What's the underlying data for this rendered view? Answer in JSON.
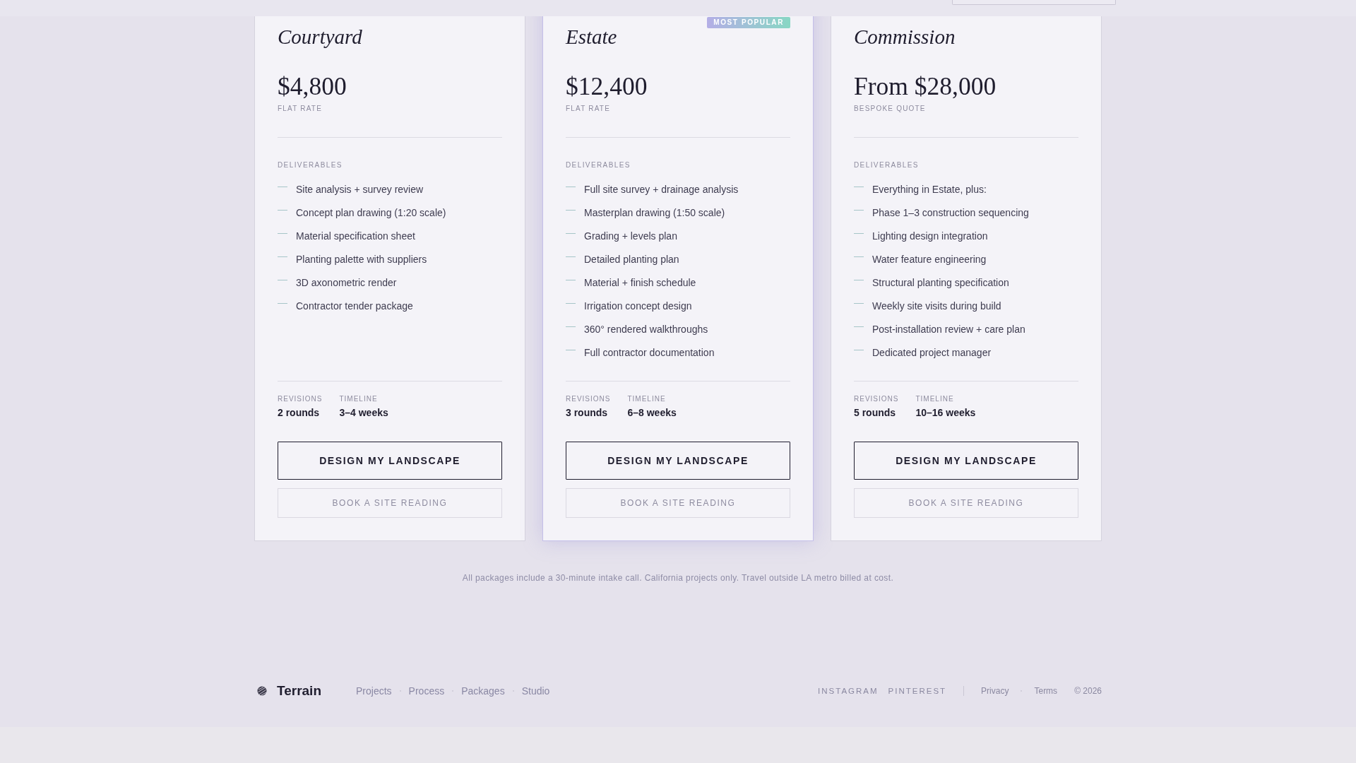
{
  "packages": [
    {
      "name": "Courtyard",
      "featured": false,
      "price": "$4,800",
      "price_note": "FLAT RATE",
      "deliverables_label": "DELIVERABLES",
      "deliverables": [
        "Site analysis + survey review",
        "Concept plan drawing (1:20 scale)",
        "Material specification sheet",
        "Planting palette with suppliers",
        "3D axonometric render",
        "Contractor tender package"
      ],
      "stats": [
        {
          "label": "REVISIONS",
          "value": "2 rounds"
        },
        {
          "label": "TIMELINE",
          "value": "3–4 weeks"
        }
      ],
      "primary_action": "DESIGN MY LANDSCAPE",
      "secondary_action": "BOOK A SITE READING"
    },
    {
      "name": "Estate",
      "featured": true,
      "badge": "MOST POPULAR",
      "price": "$12,400",
      "price_note": "FLAT RATE",
      "deliverables_label": "DELIVERABLES",
      "deliverables": [
        "Full site survey + drainage analysis",
        "Masterplan drawing (1:50 scale)",
        "Grading + levels plan",
        "Detailed planting plan",
        "Material + finish schedule",
        "Irrigation concept design",
        "360° rendered walkthroughs",
        "Full contractor documentation"
      ],
      "stats": [
        {
          "label": "REVISIONS",
          "value": "3 rounds"
        },
        {
          "label": "TIMELINE",
          "value": "6–8 weeks"
        }
      ],
      "primary_action": "DESIGN MY LANDSCAPE",
      "secondary_action": "BOOK A SITE READING"
    },
    {
      "name": "Commission",
      "featured": false,
      "price": "From $28,000",
      "price_note": "BESPOKE QUOTE",
      "deliverables_label": "DELIVERABLES",
      "deliverables": [
        "Everything in Estate, plus:",
        "Phase 1–3 construction sequencing",
        "Lighting design integration",
        "Water feature engineering",
        "Structural planting specification",
        "Weekly site visits during build",
        "Post-installation review + care plan",
        "Dedicated project manager"
      ],
      "stats": [
        {
          "label": "REVISIONS",
          "value": "5 rounds"
        },
        {
          "label": "TIMELINE",
          "value": "10–16 weeks"
        }
      ],
      "primary_action": "DESIGN MY LANDSCAPE",
      "secondary_action": "BOOK A SITE READING"
    }
  ],
  "note": "All packages include a 30-minute intake call. California projects only. Travel outside LA metro billed at cost.",
  "footer": {
    "brand": "Terrain",
    "nav": [
      "Projects",
      "Process",
      "Packages",
      "Studio"
    ],
    "social": [
      "INSTAGRAM",
      "PINTEREST"
    ],
    "legal": [
      "Privacy",
      "Terms"
    ],
    "copyright": "© 2026"
  }
}
